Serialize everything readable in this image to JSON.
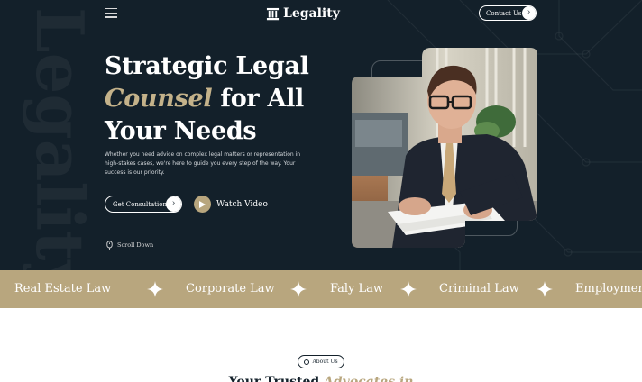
{
  "header": {
    "brand": "Legality",
    "contact_label": "Contact Us"
  },
  "hero": {
    "background_word": "Legality",
    "headline_line1": "Strategic Legal",
    "headline_accent": "Counsel",
    "headline_line2_rest": " for All",
    "headline_line3": "Your Needs",
    "subtext": "Whether you need advice on complex legal matters or representation in high-stakes cases, we're here to guide you every step of the way. Your success is our priority.",
    "cta_label": "Get Consultation",
    "video_label": "Watch Video",
    "scroll_label": "Scroll Down"
  },
  "ticker": {
    "items": [
      "Real Estate Law",
      "Corporate Law",
      "Faly Law",
      "Criminal Law",
      "Employmen"
    ]
  },
  "about": {
    "pill_label": "About Us",
    "heading_left": "Your Trusted",
    "heading_accent": "Advocates in"
  },
  "colors": {
    "navy": "#13202a",
    "gold": "#b8a67e",
    "white": "#ffffff"
  },
  "icons": {
    "menu": "hamburger-icon",
    "logo": "courthouse-pillar-icon",
    "arrow": "arrow-right-icon",
    "play": "play-icon",
    "scroll": "mouse-scroll-icon",
    "star": "four-point-star-icon"
  }
}
